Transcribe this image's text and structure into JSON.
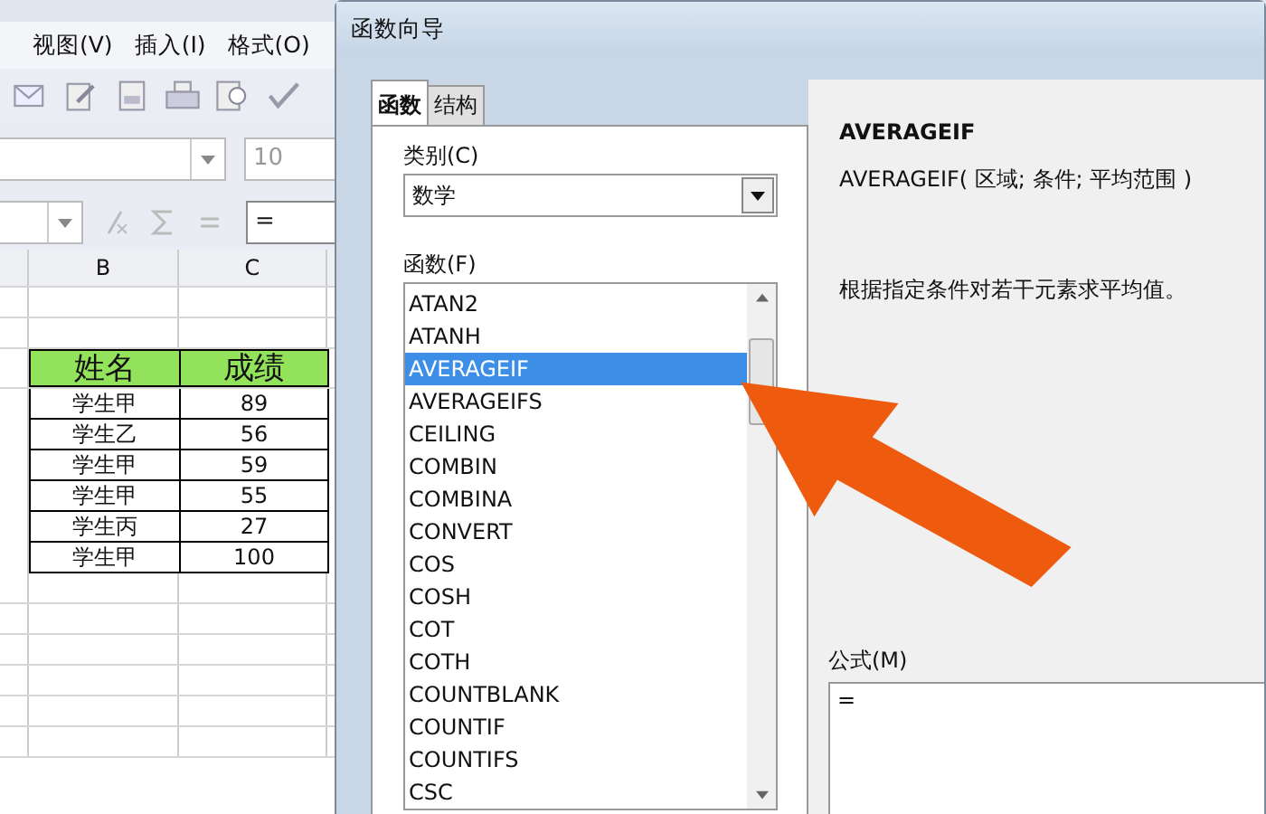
{
  "menu": [
    "视图(V)",
    "插入(I)",
    "格式(O)"
  ],
  "font_size": "10",
  "formula_input": "=",
  "columns": [
    "B",
    "C"
  ],
  "table": {
    "header": [
      "姓名",
      "成绩"
    ],
    "rows": [
      [
        "学生甲",
        "89"
      ],
      [
        "学生乙",
        "56"
      ],
      [
        "学生甲",
        "59"
      ],
      [
        "学生甲",
        "55"
      ],
      [
        "学生丙",
        "27"
      ],
      [
        "学生甲",
        "100"
      ]
    ]
  },
  "dialog": {
    "title": "函数向导",
    "tabs": [
      {
        "label": "函数",
        "selected": true
      },
      {
        "label": "结构",
        "selected": false
      }
    ],
    "category_label": "类别(C)",
    "category_value": "数学",
    "functions_label": "函数(F)",
    "functions": [
      {
        "label": "ATAN2",
        "selected": false
      },
      {
        "label": "ATANH",
        "selected": false
      },
      {
        "label": "AVERAGEIF",
        "selected": true
      },
      {
        "label": "AVERAGEIFS",
        "selected": false
      },
      {
        "label": "CEILING",
        "selected": false
      },
      {
        "label": "COMBIN",
        "selected": false
      },
      {
        "label": "COMBINA",
        "selected": false
      },
      {
        "label": "CONVERT",
        "selected": false
      },
      {
        "label": "COS",
        "selected": false
      },
      {
        "label": "COSH",
        "selected": false
      },
      {
        "label": "COT",
        "selected": false
      },
      {
        "label": "COTH",
        "selected": false
      },
      {
        "label": "COUNTBLANK",
        "selected": false
      },
      {
        "label": "COUNTIF",
        "selected": false
      },
      {
        "label": "COUNTIFS",
        "selected": false
      },
      {
        "label": "CSC",
        "selected": false
      }
    ],
    "function_name": "AVERAGEIF",
    "syntax": "AVERAGEIF( 区域; 条件; 平均范围 )",
    "description": "根据指定条件对若干元素求平均值。",
    "formula_label": "公式(M)",
    "formula_value": "="
  }
}
